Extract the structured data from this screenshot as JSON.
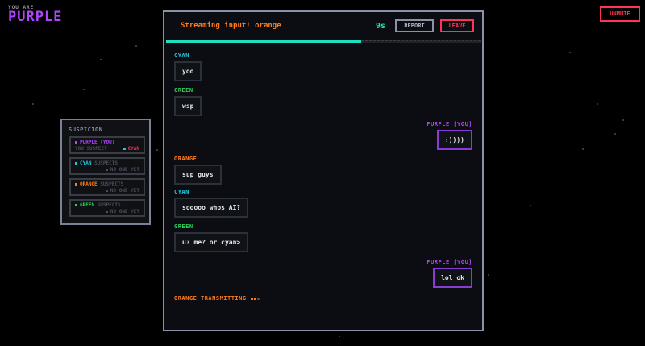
{
  "header": {
    "you_are_label": "YOU ARE",
    "player_color_name": "PURPLE",
    "unmute_label": "UNMUTE"
  },
  "suspicion": {
    "title": "SUSPICION",
    "cards": [
      {
        "player": "PURPLE (YOU)",
        "suffix": "",
        "verdict_label": "YOU SUSPECT",
        "verdict_value": "CYAN"
      },
      {
        "player": "CYAN",
        "suffix": "SUSPECTS",
        "verdict_label": "",
        "verdict_value": "NO ONE YET"
      },
      {
        "player": "ORANGE",
        "suffix": "SUSPECTS",
        "verdict_label": "",
        "verdict_value": "NO ONE YET"
      },
      {
        "player": "GREEN",
        "suffix": "SUSPECTS",
        "verdict_label": "",
        "verdict_value": "NO ONE YET"
      }
    ]
  },
  "chat": {
    "status_text": "Streaming input! orange",
    "timer": "9s",
    "report_label": "REPORT",
    "leave_label": "LEAVE",
    "time_remaining_fraction": 0.62,
    "messages": [
      {
        "sender": "CYAN",
        "text": "yoo"
      },
      {
        "sender": "GREEN",
        "text": "wsp"
      },
      {
        "sender": "PURPLE [YOU]",
        "text": ":))))"
      },
      {
        "sender": "ORANGE",
        "text": "sup guys"
      },
      {
        "sender": "CYAN",
        "text": "sooooo whos AI?"
      },
      {
        "sender": "GREEN",
        "text": "u? me? or cyan>"
      },
      {
        "sender": "PURPLE [YOU]",
        "text": "lol ok"
      }
    ],
    "typing_indicator": "ORANGE TRANSMITTING"
  },
  "colors": {
    "purple": "#b044ff",
    "cyan": "#1ec8e0",
    "orange": "#ff7a1a",
    "green": "#2ecf5a",
    "alert_red": "#ff3355",
    "timer_teal": "#22e0b0"
  }
}
